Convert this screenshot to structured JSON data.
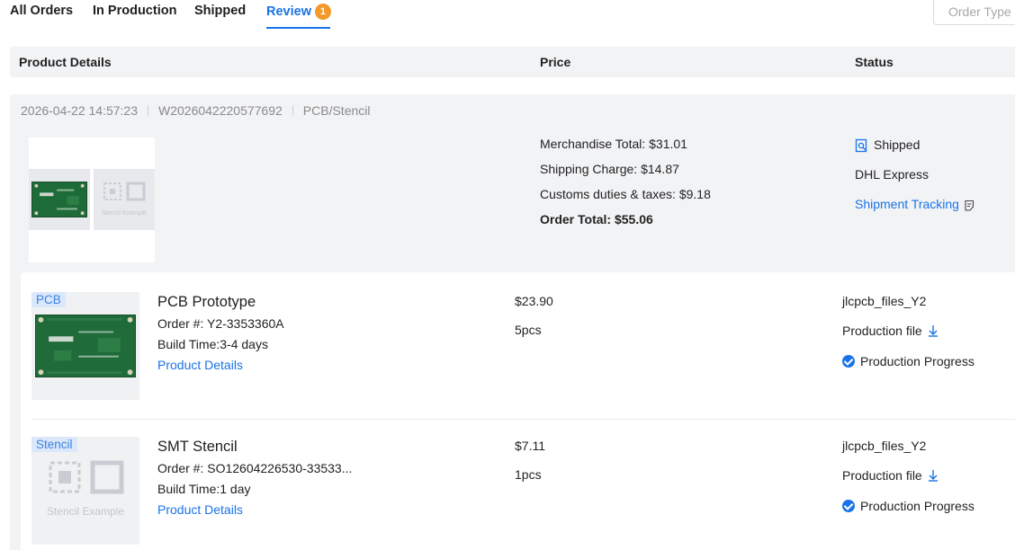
{
  "tabs": [
    {
      "label": "All Orders"
    },
    {
      "label": "In Production"
    },
    {
      "label": "Shipped"
    },
    {
      "label": "Review",
      "badge": "1"
    }
  ],
  "order_type_placeholder": "Order Type",
  "table_header": {
    "product": "Product Details",
    "price": "Price",
    "status": "Status"
  },
  "order": {
    "datetime": "2026-04-22 14:57:23",
    "order_id": "W2026042220577692",
    "category": "PCB/Stencil",
    "combo_stencil_caption": "Stencil Example",
    "summary": {
      "merchandise": "Merchandise Total: $31.01",
      "shipping": "Shipping Charge: $14.87",
      "customs": "Customs duties & taxes: $9.18",
      "total": "Order Total: $55.06"
    },
    "shipping_status": {
      "status": "Shipped",
      "carrier": "DHL Express",
      "tracking_link": "Shipment Tracking"
    }
  },
  "items": [
    {
      "tag": "PCB",
      "title": "PCB Prototype",
      "order_no": "Order #: Y2-3353360A",
      "build_time": "Build Time:3-4 days",
      "details_link": "Product Details",
      "price": "$23.90",
      "qty": "5pcs",
      "file_name": "jlcpcb_files_Y2",
      "production_file": "Production file",
      "progress": "Production Progress"
    },
    {
      "tag": "Stencil",
      "title": "SMT Stencil",
      "order_no": "Order #: SO12604226530-33533...",
      "build_time": "Build Time:1 day",
      "details_link": "Product Details",
      "stencil_caption": "Stencil Example",
      "price": "$7.11",
      "qty": "1pcs",
      "file_name": "jlcpcb_files_Y2",
      "production_file": "Production file",
      "progress": "Production Progress"
    }
  ],
  "colors": {
    "accent": "#1a73e8",
    "badge": "#f39a2c",
    "panel_bg": "#f2f3f5",
    "pcb_green": "#1f6b3a"
  }
}
